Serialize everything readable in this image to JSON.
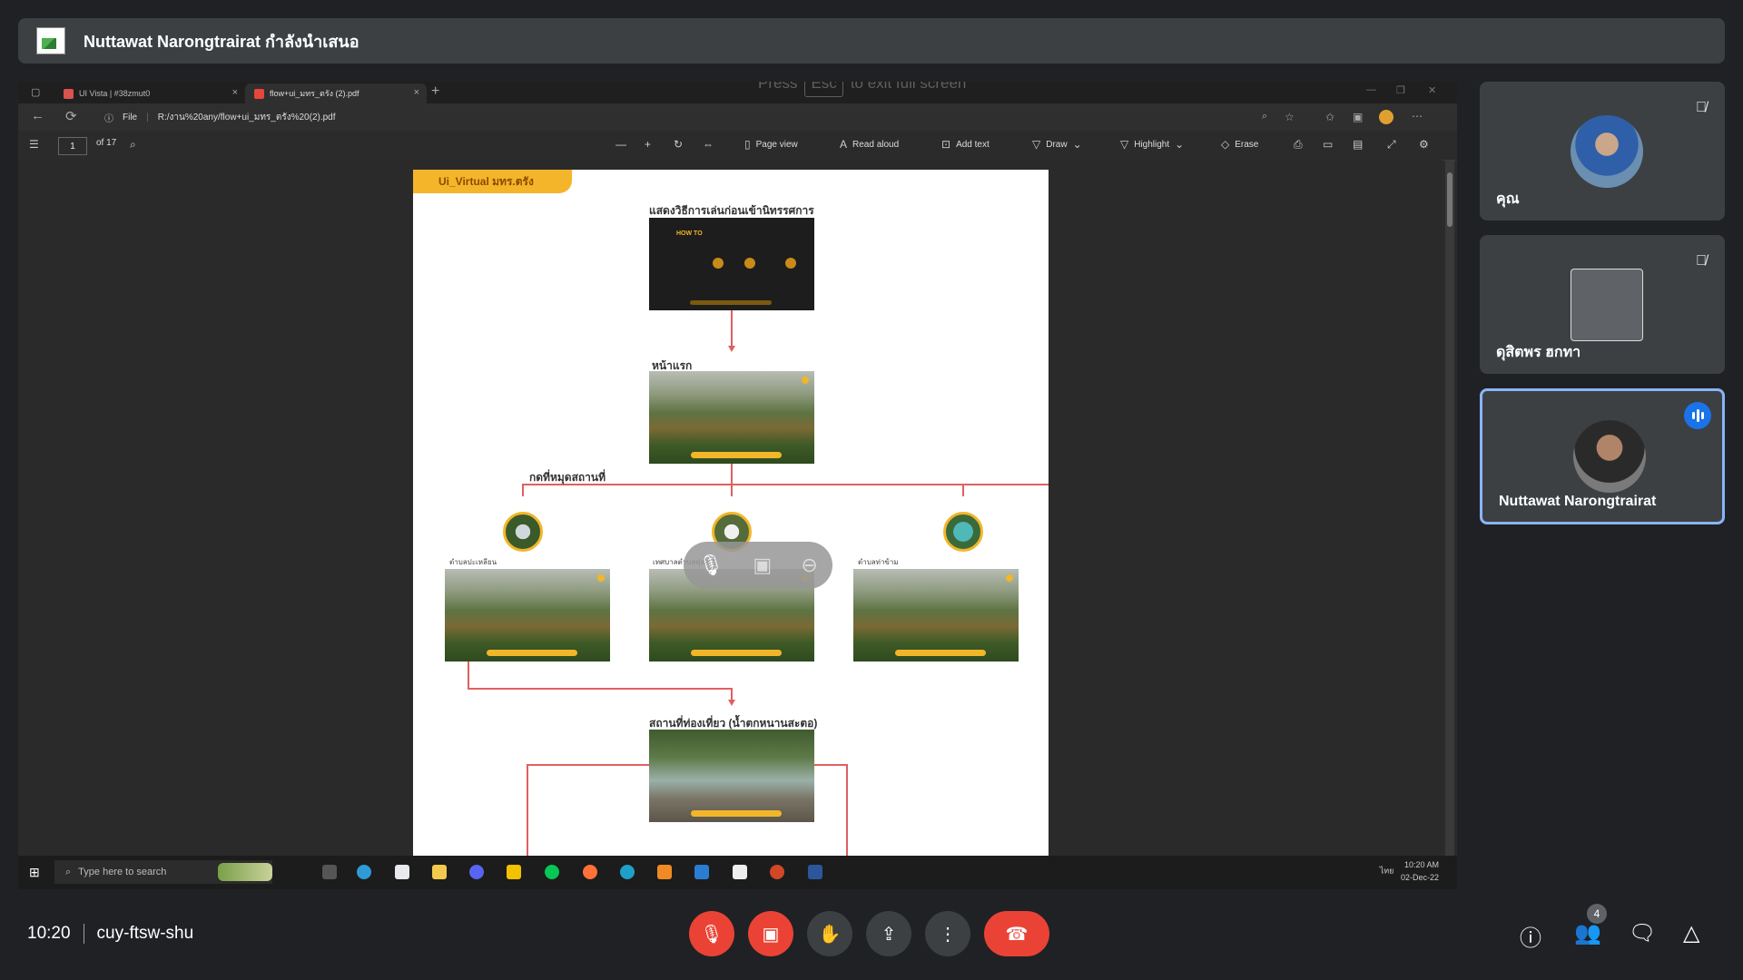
{
  "presenter_banner": {
    "title": "Nuttawat Narongtrairat กำลังนำเสนอ"
  },
  "fullscreen_hint": {
    "before": "Press",
    "key": "Esc",
    "after": "to exit full screen"
  },
  "browser": {
    "tabs": [
      {
        "label": "UI Vista | #38zmut0"
      },
      {
        "label": "flow+ui_มทร_ตรัง (2).pdf"
      }
    ],
    "url_prefix": "File",
    "url": "R:/งาน%20any/flow+ui_มทร_ตรัง%20(2).pdf"
  },
  "pdf_toolbar": {
    "page": "1",
    "of_pages": "of 17",
    "page_view": "Page view",
    "read_aloud": "Read aloud",
    "add_text": "Add text",
    "draw": "Draw",
    "highlight": "Highlight",
    "erase": "Erase"
  },
  "pdf_page": {
    "tag": "Ui_Virtual มทร.ตรัง",
    "heading_intro": "แสดงวิธีการเล่นก่อนเข้านิทรรศการ",
    "intro_howto": "HOW TO",
    "heading_home": "หน้าแรก",
    "pin_label": "กดที่หมุดสถานที่",
    "place_left": "ตำบลปะเหลียน",
    "place_center": "เทศบาลตำบลทุ่งยาว",
    "place_right": "ตำบลท่าข้าม",
    "heading_tour": "สถานที่ท่องเที่ยว (น้ำตกหนานสะตอ)"
  },
  "taskbar": {
    "search_placeholder": "Type here to search",
    "time": "10:20 AM",
    "date": "02-Dec-22",
    "lang": "ไทย"
  },
  "participants": [
    {
      "name": "คุณ"
    },
    {
      "name": "ดุสิตพร ฮกทา"
    },
    {
      "name": "Nuttawat Narongtrairat"
    }
  ],
  "meeting": {
    "time": "10:20",
    "code": "cuy-ftsw-shu",
    "people_count": "4"
  },
  "colors": {
    "end_call": "#ea4335",
    "active_border": "#8ab4f8",
    "speaking": "#1a73e8",
    "pdf_accent": "#f2b629"
  },
  "icons": [
    "mic-off-icon",
    "camera-off-icon",
    "hand-icon",
    "present-icon",
    "more-icon",
    "end-call-icon",
    "info-icon",
    "people-icon",
    "chat-icon",
    "activities-icon"
  ]
}
